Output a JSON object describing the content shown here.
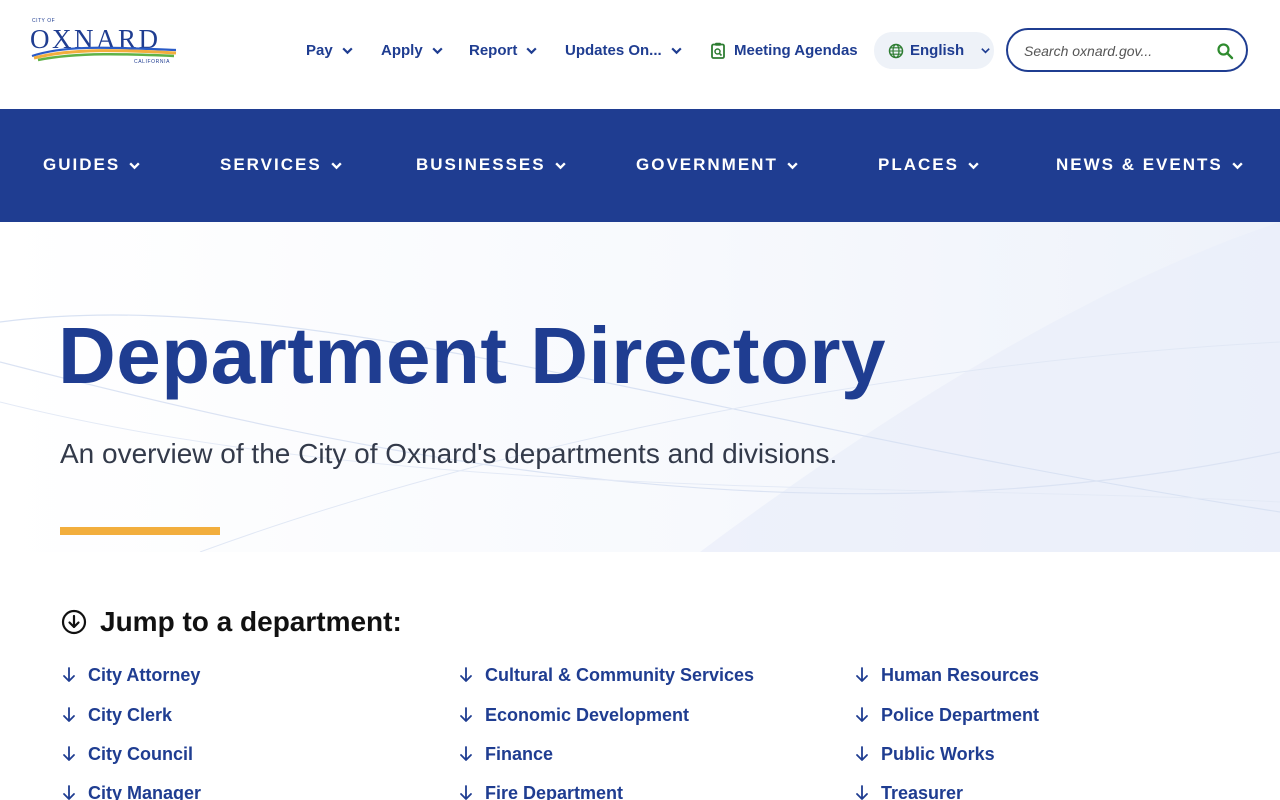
{
  "logo": {
    "top_text": "CITY OF",
    "name": "OXNARD",
    "bottom_text": "CALIFORNIA",
    "colors": {
      "navy": "#1f3d91",
      "orange": "#f2ae3d",
      "green": "#5fb246",
      "blue": "#2a5bc7"
    }
  },
  "utility_nav": [
    {
      "label": "Pay",
      "icon": "chevron-down-icon"
    },
    {
      "label": "Apply",
      "icon": "chevron-down-icon"
    },
    {
      "label": "Report",
      "icon": "chevron-down-icon"
    },
    {
      "label": "Updates On...",
      "icon": "chevron-down-icon"
    },
    {
      "label": "Meeting Agendas",
      "icon": "clipboard-search-icon"
    }
  ],
  "language": {
    "label": "English",
    "icon": "globe-icon"
  },
  "search": {
    "placeholder": "Search oxnard.gov...",
    "icon": "search-icon"
  },
  "main_nav": [
    {
      "label": "GUIDES"
    },
    {
      "label": "SERVICES"
    },
    {
      "label": "BUSINESSES"
    },
    {
      "label": "GOVERNMENT"
    },
    {
      "label": "PLACES"
    },
    {
      "label": "NEWS & EVENTS"
    }
  ],
  "hero": {
    "title": "Department Directory",
    "subtitle": "An overview of the City of Oxnard's departments and divisions."
  },
  "jump": {
    "heading": "Jump to a department:",
    "columns": [
      [
        "City Attorney",
        "City Clerk",
        "City Council",
        "City Manager"
      ],
      [
        "Cultural & Community Services",
        "Economic Development",
        "Finance",
        "Fire Department"
      ],
      [
        "Human Resources",
        "Police Department",
        "Public Works",
        "Treasurer"
      ]
    ]
  },
  "colors": {
    "primary": "#1f3d91",
    "accent": "#f2ae3d",
    "search_icon": "#2e8b2e",
    "agenda_icon": "#2e7d32"
  }
}
